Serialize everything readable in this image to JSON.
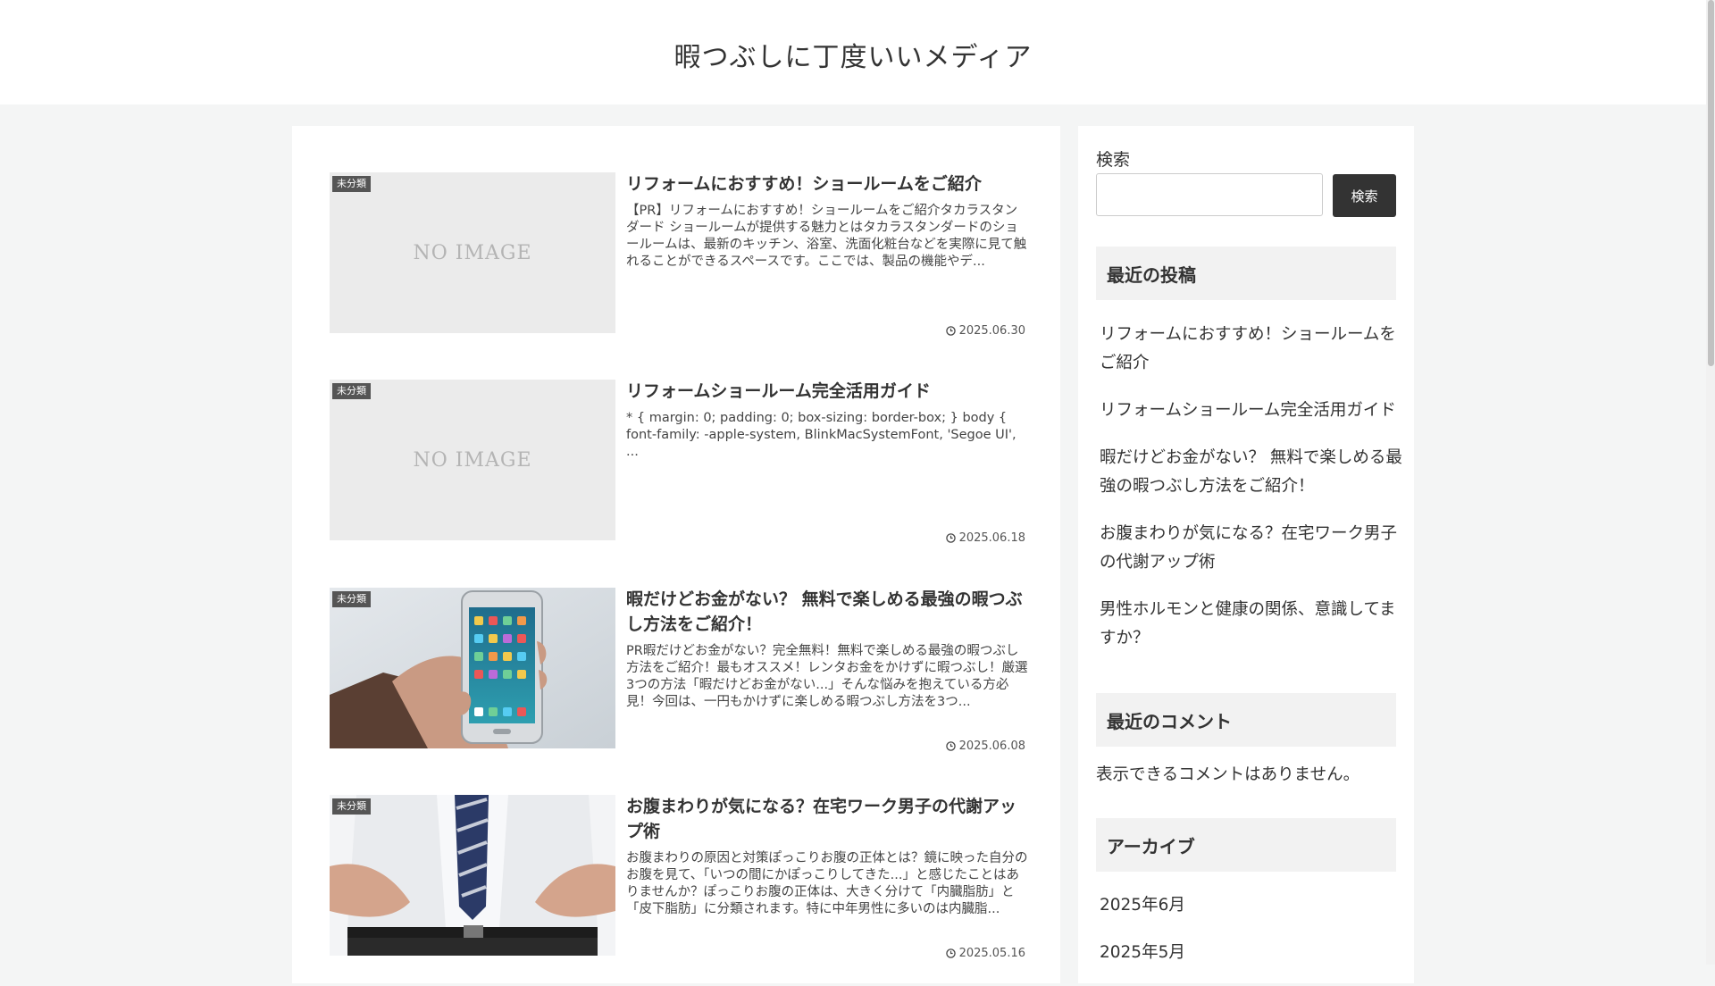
{
  "site": {
    "title": "暇つぶしに丁度いいメディア"
  },
  "posts": [
    {
      "category": "未分類",
      "thumbnail": "NO IMAGE",
      "title": "リフォームにおすすめ！ショールームをご紹介",
      "snippet": "【PR】リフォームにおすすめ！ショールームをご紹介タカラスタンダード ショールームが提供する魅力とはタカラスタンダードのショールームは、最新のキッチン、浴室、洗面化粧台などを実際に見て触れることができるスペースです。ここでは、製品の機能やデ...",
      "date": "2025.06.30"
    },
    {
      "category": "未分類",
      "thumbnail": "NO IMAGE",
      "title": "リフォームショールーム完全活用ガイド",
      "snippet": "* { margin: 0; padding: 0; box-sizing: border-box; } body { font-family: -apple-system, BlinkMacSystemFont, 'Segoe UI', ...",
      "date": "2025.06.18"
    },
    {
      "category": "未分類",
      "thumbnail": "smartphone-photo",
      "title": "暇だけどお金がない？ 無料で楽しめる最強の暇つぶし方法をご紹介！",
      "snippet": "PR暇だけどお金がない？完全無料！無料で楽しめる最強の暇つぶし方法をご紹介！最もオススメ！レンタお金をかけずに暇つぶし！厳選3つの方法「暇だけどお金がない...」そんな悩みを抱えている方必見！今回は、一円もかけずに楽しめる暇つぶし方法を3つ...",
      "date": "2025.06.08"
    },
    {
      "category": "未分類",
      "thumbnail": "belly-photo",
      "title": "お腹まわりが気になる？在宅ワーク男子の代謝アップ術",
      "snippet": "お腹まわりの原因と対策ぽっこりお腹の正体とは？鏡に映った自分のお腹を見て、「いつの間にかぽっこりしてきた...」と感じたことはありませんか？ぽっこりお腹の正体は、大きく分けて「内臓脂肪」と「皮下脂肪」に分類されます。特に中年男性に多いのは内臓脂...",
      "date": "2025.05.16"
    }
  ],
  "sidebar": {
    "search_label": "検索",
    "search_value": "",
    "search_button": "検索",
    "recent_posts_heading": "最近の投稿",
    "recent_posts": [
      "リフォームにおすすめ！ショールームをご紹介",
      "リフォームショールーム完全活用ガイド",
      "暇だけどお金がない？ 無料で楽しめる最強の暇つぶし方法をご紹介！",
      "お腹まわりが気になる？在宅ワーク男子の代謝アップ術",
      "男性ホルモンと健康の関係、意識してますか？"
    ],
    "recent_comments_heading": "最近のコメント",
    "no_comments": "表示できるコメントはありません。",
    "archives_heading": "アーカイブ",
    "archives": [
      "2025年6月",
      "2025年5月"
    ]
  }
}
